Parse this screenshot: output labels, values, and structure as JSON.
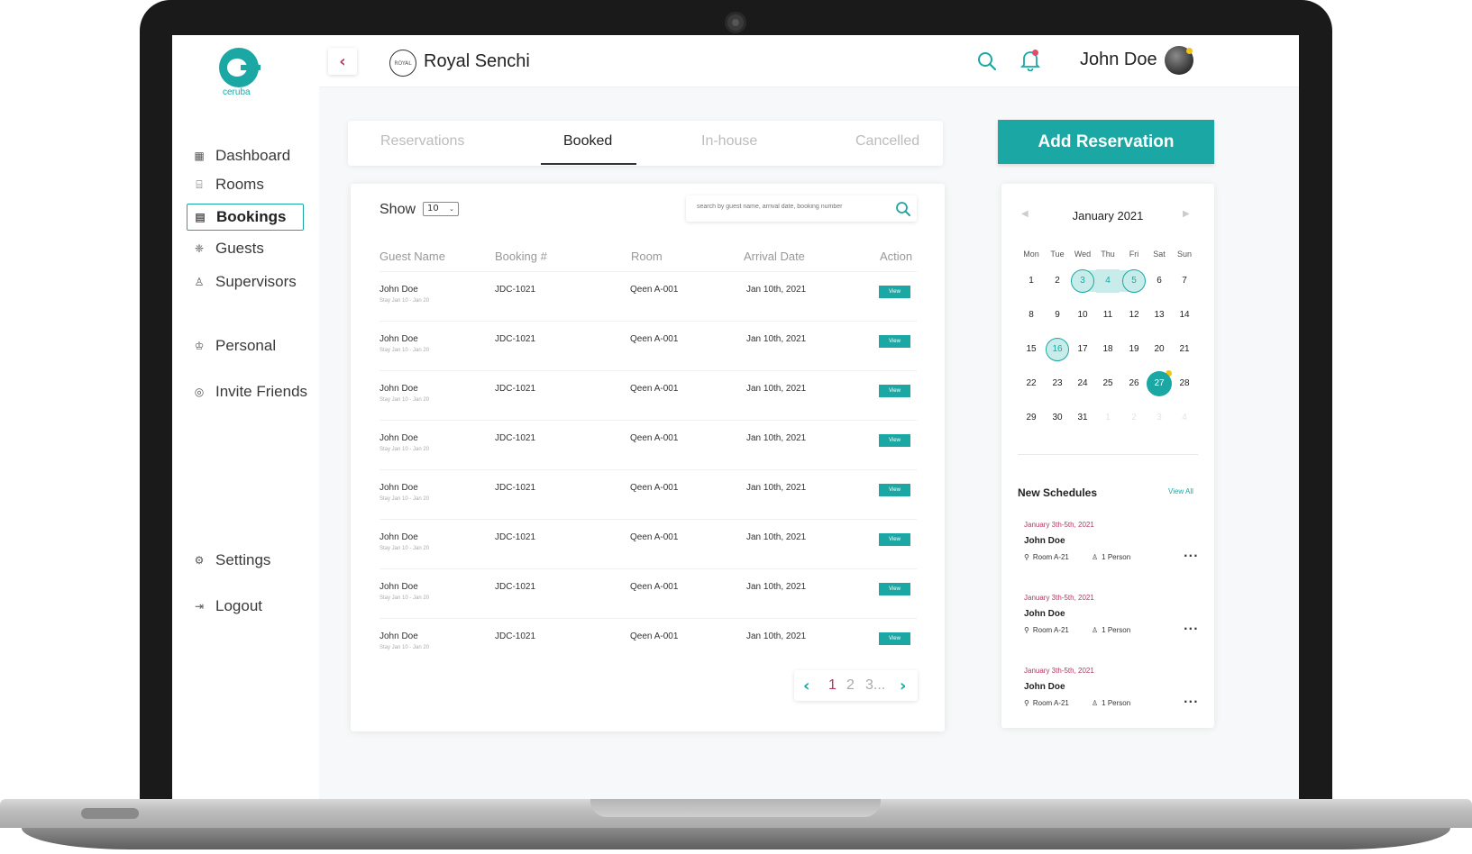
{
  "brand": {
    "logo_text": "ceruba",
    "accent": "#1ba8a4",
    "accent_dark": "#b23a5e"
  },
  "sidebar": {
    "items": [
      {
        "label": "Dashboard",
        "icon": "dashboard-icon"
      },
      {
        "label": "Rooms",
        "icon": "bed-icon"
      },
      {
        "label": "Bookings",
        "icon": "calendar-icon",
        "active": true
      },
      {
        "label": "Guests",
        "icon": "guests-icon"
      },
      {
        "label": "Supervisors",
        "icon": "supervisor-icon"
      },
      {
        "label": "Personal",
        "icon": "user-icon"
      },
      {
        "label": "Invite Friends",
        "icon": "invite-icon"
      },
      {
        "label": "Settings",
        "icon": "gear-icon"
      },
      {
        "label": "Logout",
        "icon": "logout-icon"
      }
    ]
  },
  "header": {
    "hotel_logo_text": "ROYAL",
    "hotel_name": "Royal Senchi",
    "user_name": "John Doe"
  },
  "tabs": [
    "Reservations",
    "Booked",
    "In-house",
    "Cancelled"
  ],
  "add_reservation_label": "Add Reservation",
  "table": {
    "show_label": "Show",
    "show_value": "10",
    "search_placeholder": "search by guest name, arrival date, booking number",
    "columns": [
      "Guest Name",
      "Booking #",
      "Room",
      "Arrival Date",
      "Action"
    ],
    "rows": [
      {
        "name": "John Doe",
        "stay": "Stay Jan 10 - Jan 20",
        "booking": "JDC-1021",
        "room": "Qeen A-001",
        "arrival": "Jan 10th, 2021",
        "action": "View"
      },
      {
        "name": "John Doe",
        "stay": "Stay Jan 10 - Jan 20",
        "booking": "JDC-1021",
        "room": "Qeen A-001",
        "arrival": "Jan 10th, 2021",
        "action": "View"
      },
      {
        "name": "John Doe",
        "stay": "Stay Jan 10 - Jan 20",
        "booking": "JDC-1021",
        "room": "Qeen A-001",
        "arrival": "Jan 10th, 2021",
        "action": "View"
      },
      {
        "name": "John Doe",
        "stay": "Stay Jan 10 - Jan 20",
        "booking": "JDC-1021",
        "room": "Qeen A-001",
        "arrival": "Jan 10th, 2021",
        "action": "View"
      },
      {
        "name": "John Doe",
        "stay": "Stay Jan 10 - Jan 20",
        "booking": "JDC-1021",
        "room": "Qeen A-001",
        "arrival": "Jan 10th, 2021",
        "action": "View"
      },
      {
        "name": "John Doe",
        "stay": "Stay Jan 10 - Jan 20",
        "booking": "JDC-1021",
        "room": "Qeen A-001",
        "arrival": "Jan 10th, 2021",
        "action": "View"
      },
      {
        "name": "John Doe",
        "stay": "Stay Jan 10 - Jan 20",
        "booking": "JDC-1021",
        "room": "Qeen A-001",
        "arrival": "Jan 10th, 2021",
        "action": "View"
      },
      {
        "name": "John Doe",
        "stay": "Stay Jan 10 - Jan 20",
        "booking": "JDC-1021",
        "room": "Qeen A-001",
        "arrival": "Jan 10th, 2021",
        "action": "View"
      }
    ],
    "pagination": {
      "page_1": "1",
      "page_2": "2",
      "page_3": "3..."
    }
  },
  "calendar": {
    "month": "January 2021",
    "days_of_week": [
      "Mon",
      "Tue",
      "Wed",
      "Thu",
      "Fri",
      "Sat",
      "Sun"
    ],
    "weeks": [
      [
        "1",
        "2",
        "3",
        "4",
        "5",
        "6",
        "7"
      ],
      [
        "8",
        "9",
        "10",
        "11",
        "12",
        "13",
        "14"
      ],
      [
        "15",
        "16",
        "17",
        "18",
        "19",
        "20",
        "21"
      ],
      [
        "22",
        "23",
        "24",
        "25",
        "26",
        "27",
        "28"
      ],
      [
        "29",
        "30",
        "31",
        "1",
        "2",
        "3",
        "4"
      ]
    ],
    "highlighted_range": [
      "3",
      "4",
      "5"
    ],
    "highlighted_single": "16",
    "today": "27"
  },
  "schedules": {
    "title": "New Schedules",
    "view_all": "View All",
    "items": [
      {
        "date": "January 3th-5th, 2021",
        "name": "John Doe",
        "room": "Room A-21",
        "persons": "1 Person"
      },
      {
        "date": "January 3th-5th, 2021",
        "name": "John Doe",
        "room": "Room A-21",
        "persons": "1 Person"
      },
      {
        "date": "January 3th-5th, 2021",
        "name": "John Doe",
        "room": "Room A-21",
        "persons": "1 Person"
      }
    ]
  }
}
